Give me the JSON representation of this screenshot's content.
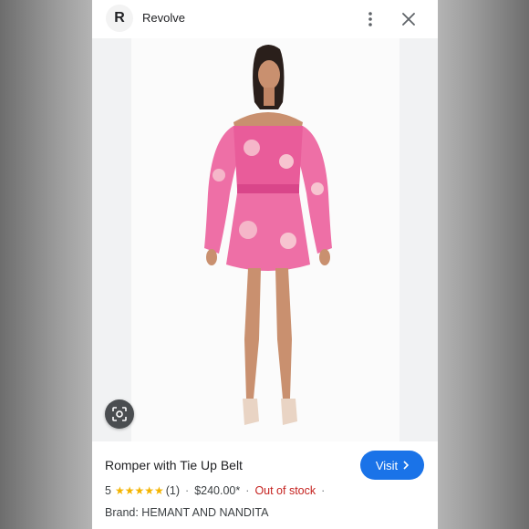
{
  "header": {
    "site_logo_letter": "R",
    "site_name": "Revolve"
  },
  "product": {
    "title": "Romper with Tie Up Belt",
    "rating": "5",
    "stars": "★★★★★",
    "review_count": "(1)",
    "price": "$240.00*",
    "stock_status": "Out of stock",
    "brand": "Brand: HEMANT AND NANDITA"
  },
  "actions": {
    "visit_label": "Visit"
  },
  "colors": {
    "visit_button": "#1a73e8",
    "stock_status": "#c5221f",
    "stars": "#f4b400"
  },
  "icons": [
    "more-vert-icon",
    "close-icon",
    "google-lens-icon",
    "chevron-right-icon"
  ]
}
